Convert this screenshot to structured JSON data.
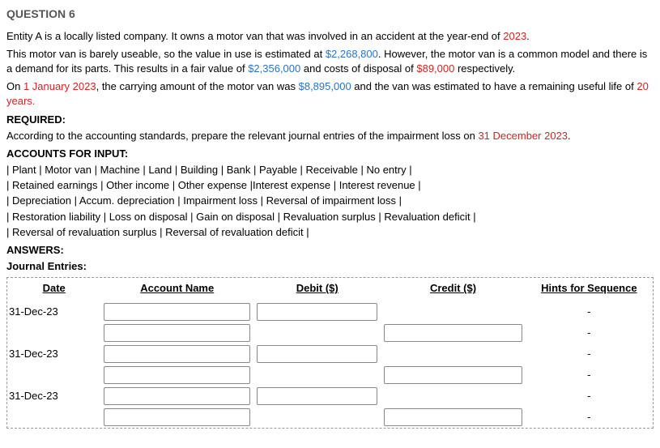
{
  "title": "QUESTION 6",
  "p1_a": "Entity A is a locally listed company.  It owns a motor van that was involved in an accident at the year-end of ",
  "p1_year": "2023",
  "p1_b": ".",
  "p2_a": "This motor van is barely useable, so the value in use is estimated at ",
  "p2_viu": "$2,268,800",
  "p2_b": ".  However, the motor van is a common model and there is a demand for its parts.  This results in a fair value of ",
  "p2_fv": "$2,356,000",
  "p2_c": " and costs of disposal of ",
  "p2_cod": "$89,000",
  "p2_d": " respectively.",
  "p3_a": "On ",
  "p3_date": "1 January 2023",
  "p3_b": ", the carrying amount of the motor van was ",
  "p3_ca": "$8,895,000",
  "p3_c": " and the van was estimated to have a remaining useful life of ",
  "p3_life": "20 years.",
  "required_label": "REQUIRED:",
  "required_text_a": "According to the accounting standards, prepare the relevant journal entries of the impairment loss on ",
  "required_date": "31 December 2023",
  "required_text_b": ".",
  "accounts_label": "ACCOUNTS FOR INPUT:",
  "acct_lines": [
    "| Plant | Motor van | Machine | Land | Building | Bank | Payable | Receivable | No entry |",
    "| Retained earnings | Other income | Other expense |Interest expense | Interest revenue |",
    "| Depreciation | Accum. depreciation | Impairment loss | Reversal of impairment loss |",
    "| Restoration liability | Loss on disposal | Gain on disposal | Revaluation surplus | Revaluation deficit |",
    "| Reversal of revaluation surplus | Reversal of revaluation deficit |"
  ],
  "answers_label": "ANSWERS:",
  "je_label": "Journal Entries:",
  "headers": {
    "date": "Date",
    "account": "Account Name",
    "debit": "Debit ($)",
    "credit": "Credit ($)",
    "hints": "Hints for Sequence"
  },
  "rows": [
    {
      "date": "31-Dec-23",
      "showAccount": true,
      "showDebit": true,
      "showCredit": false,
      "hint": "-"
    },
    {
      "date": "",
      "showAccount": true,
      "showDebit": false,
      "showCredit": true,
      "hint": "-"
    },
    {
      "date": "31-Dec-23",
      "showAccount": true,
      "showDebit": true,
      "showCredit": false,
      "hint": "-"
    },
    {
      "date": "",
      "showAccount": true,
      "showDebit": false,
      "showCredit": true,
      "hint": "-"
    },
    {
      "date": "31-Dec-23",
      "showAccount": true,
      "showDebit": true,
      "showCredit": false,
      "hint": "-"
    },
    {
      "date": "",
      "showAccount": true,
      "showDebit": false,
      "showCredit": true,
      "hint": "-"
    }
  ]
}
